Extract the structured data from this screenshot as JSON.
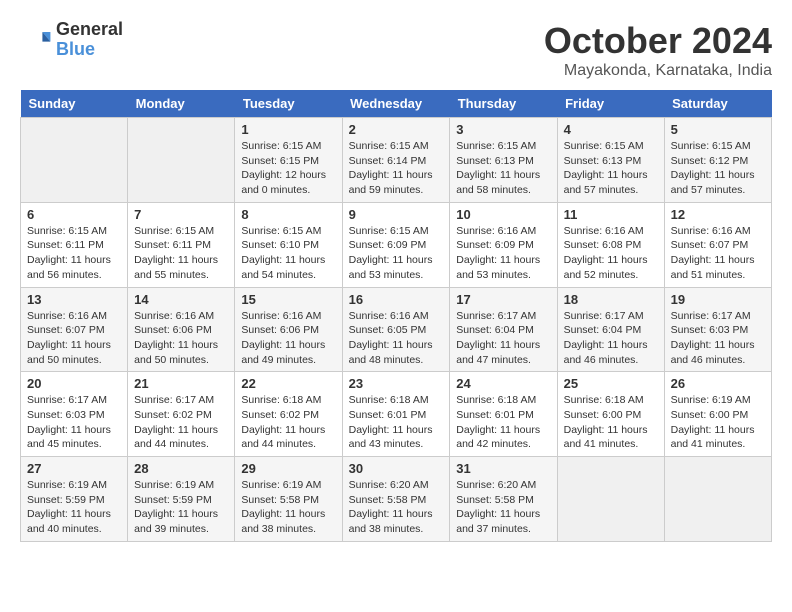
{
  "header": {
    "logo_general": "General",
    "logo_blue": "Blue",
    "month": "October 2024",
    "location": "Mayakonda, Karnataka, India"
  },
  "weekdays": [
    "Sunday",
    "Monday",
    "Tuesday",
    "Wednesday",
    "Thursday",
    "Friday",
    "Saturday"
  ],
  "weeks": [
    [
      {
        "day": "",
        "info": ""
      },
      {
        "day": "",
        "info": ""
      },
      {
        "day": "1",
        "info": "Sunrise: 6:15 AM\nSunset: 6:15 PM\nDaylight: 12 hours and 0 minutes."
      },
      {
        "day": "2",
        "info": "Sunrise: 6:15 AM\nSunset: 6:14 PM\nDaylight: 11 hours and 59 minutes."
      },
      {
        "day": "3",
        "info": "Sunrise: 6:15 AM\nSunset: 6:13 PM\nDaylight: 11 hours and 58 minutes."
      },
      {
        "day": "4",
        "info": "Sunrise: 6:15 AM\nSunset: 6:13 PM\nDaylight: 11 hours and 57 minutes."
      },
      {
        "day": "5",
        "info": "Sunrise: 6:15 AM\nSunset: 6:12 PM\nDaylight: 11 hours and 57 minutes."
      }
    ],
    [
      {
        "day": "6",
        "info": "Sunrise: 6:15 AM\nSunset: 6:11 PM\nDaylight: 11 hours and 56 minutes."
      },
      {
        "day": "7",
        "info": "Sunrise: 6:15 AM\nSunset: 6:11 PM\nDaylight: 11 hours and 55 minutes."
      },
      {
        "day": "8",
        "info": "Sunrise: 6:15 AM\nSunset: 6:10 PM\nDaylight: 11 hours and 54 minutes."
      },
      {
        "day": "9",
        "info": "Sunrise: 6:15 AM\nSunset: 6:09 PM\nDaylight: 11 hours and 53 minutes."
      },
      {
        "day": "10",
        "info": "Sunrise: 6:16 AM\nSunset: 6:09 PM\nDaylight: 11 hours and 53 minutes."
      },
      {
        "day": "11",
        "info": "Sunrise: 6:16 AM\nSunset: 6:08 PM\nDaylight: 11 hours and 52 minutes."
      },
      {
        "day": "12",
        "info": "Sunrise: 6:16 AM\nSunset: 6:07 PM\nDaylight: 11 hours and 51 minutes."
      }
    ],
    [
      {
        "day": "13",
        "info": "Sunrise: 6:16 AM\nSunset: 6:07 PM\nDaylight: 11 hours and 50 minutes."
      },
      {
        "day": "14",
        "info": "Sunrise: 6:16 AM\nSunset: 6:06 PM\nDaylight: 11 hours and 50 minutes."
      },
      {
        "day": "15",
        "info": "Sunrise: 6:16 AM\nSunset: 6:06 PM\nDaylight: 11 hours and 49 minutes."
      },
      {
        "day": "16",
        "info": "Sunrise: 6:16 AM\nSunset: 6:05 PM\nDaylight: 11 hours and 48 minutes."
      },
      {
        "day": "17",
        "info": "Sunrise: 6:17 AM\nSunset: 6:04 PM\nDaylight: 11 hours and 47 minutes."
      },
      {
        "day": "18",
        "info": "Sunrise: 6:17 AM\nSunset: 6:04 PM\nDaylight: 11 hours and 46 minutes."
      },
      {
        "day": "19",
        "info": "Sunrise: 6:17 AM\nSunset: 6:03 PM\nDaylight: 11 hours and 46 minutes."
      }
    ],
    [
      {
        "day": "20",
        "info": "Sunrise: 6:17 AM\nSunset: 6:03 PM\nDaylight: 11 hours and 45 minutes."
      },
      {
        "day": "21",
        "info": "Sunrise: 6:17 AM\nSunset: 6:02 PM\nDaylight: 11 hours and 44 minutes."
      },
      {
        "day": "22",
        "info": "Sunrise: 6:18 AM\nSunset: 6:02 PM\nDaylight: 11 hours and 44 minutes."
      },
      {
        "day": "23",
        "info": "Sunrise: 6:18 AM\nSunset: 6:01 PM\nDaylight: 11 hours and 43 minutes."
      },
      {
        "day": "24",
        "info": "Sunrise: 6:18 AM\nSunset: 6:01 PM\nDaylight: 11 hours and 42 minutes."
      },
      {
        "day": "25",
        "info": "Sunrise: 6:18 AM\nSunset: 6:00 PM\nDaylight: 11 hours and 41 minutes."
      },
      {
        "day": "26",
        "info": "Sunrise: 6:19 AM\nSunset: 6:00 PM\nDaylight: 11 hours and 41 minutes."
      }
    ],
    [
      {
        "day": "27",
        "info": "Sunrise: 6:19 AM\nSunset: 5:59 PM\nDaylight: 11 hours and 40 minutes."
      },
      {
        "day": "28",
        "info": "Sunrise: 6:19 AM\nSunset: 5:59 PM\nDaylight: 11 hours and 39 minutes."
      },
      {
        "day": "29",
        "info": "Sunrise: 6:19 AM\nSunset: 5:58 PM\nDaylight: 11 hours and 38 minutes."
      },
      {
        "day": "30",
        "info": "Sunrise: 6:20 AM\nSunset: 5:58 PM\nDaylight: 11 hours and 38 minutes."
      },
      {
        "day": "31",
        "info": "Sunrise: 6:20 AM\nSunset: 5:58 PM\nDaylight: 11 hours and 37 minutes."
      },
      {
        "day": "",
        "info": ""
      },
      {
        "day": "",
        "info": ""
      }
    ]
  ]
}
